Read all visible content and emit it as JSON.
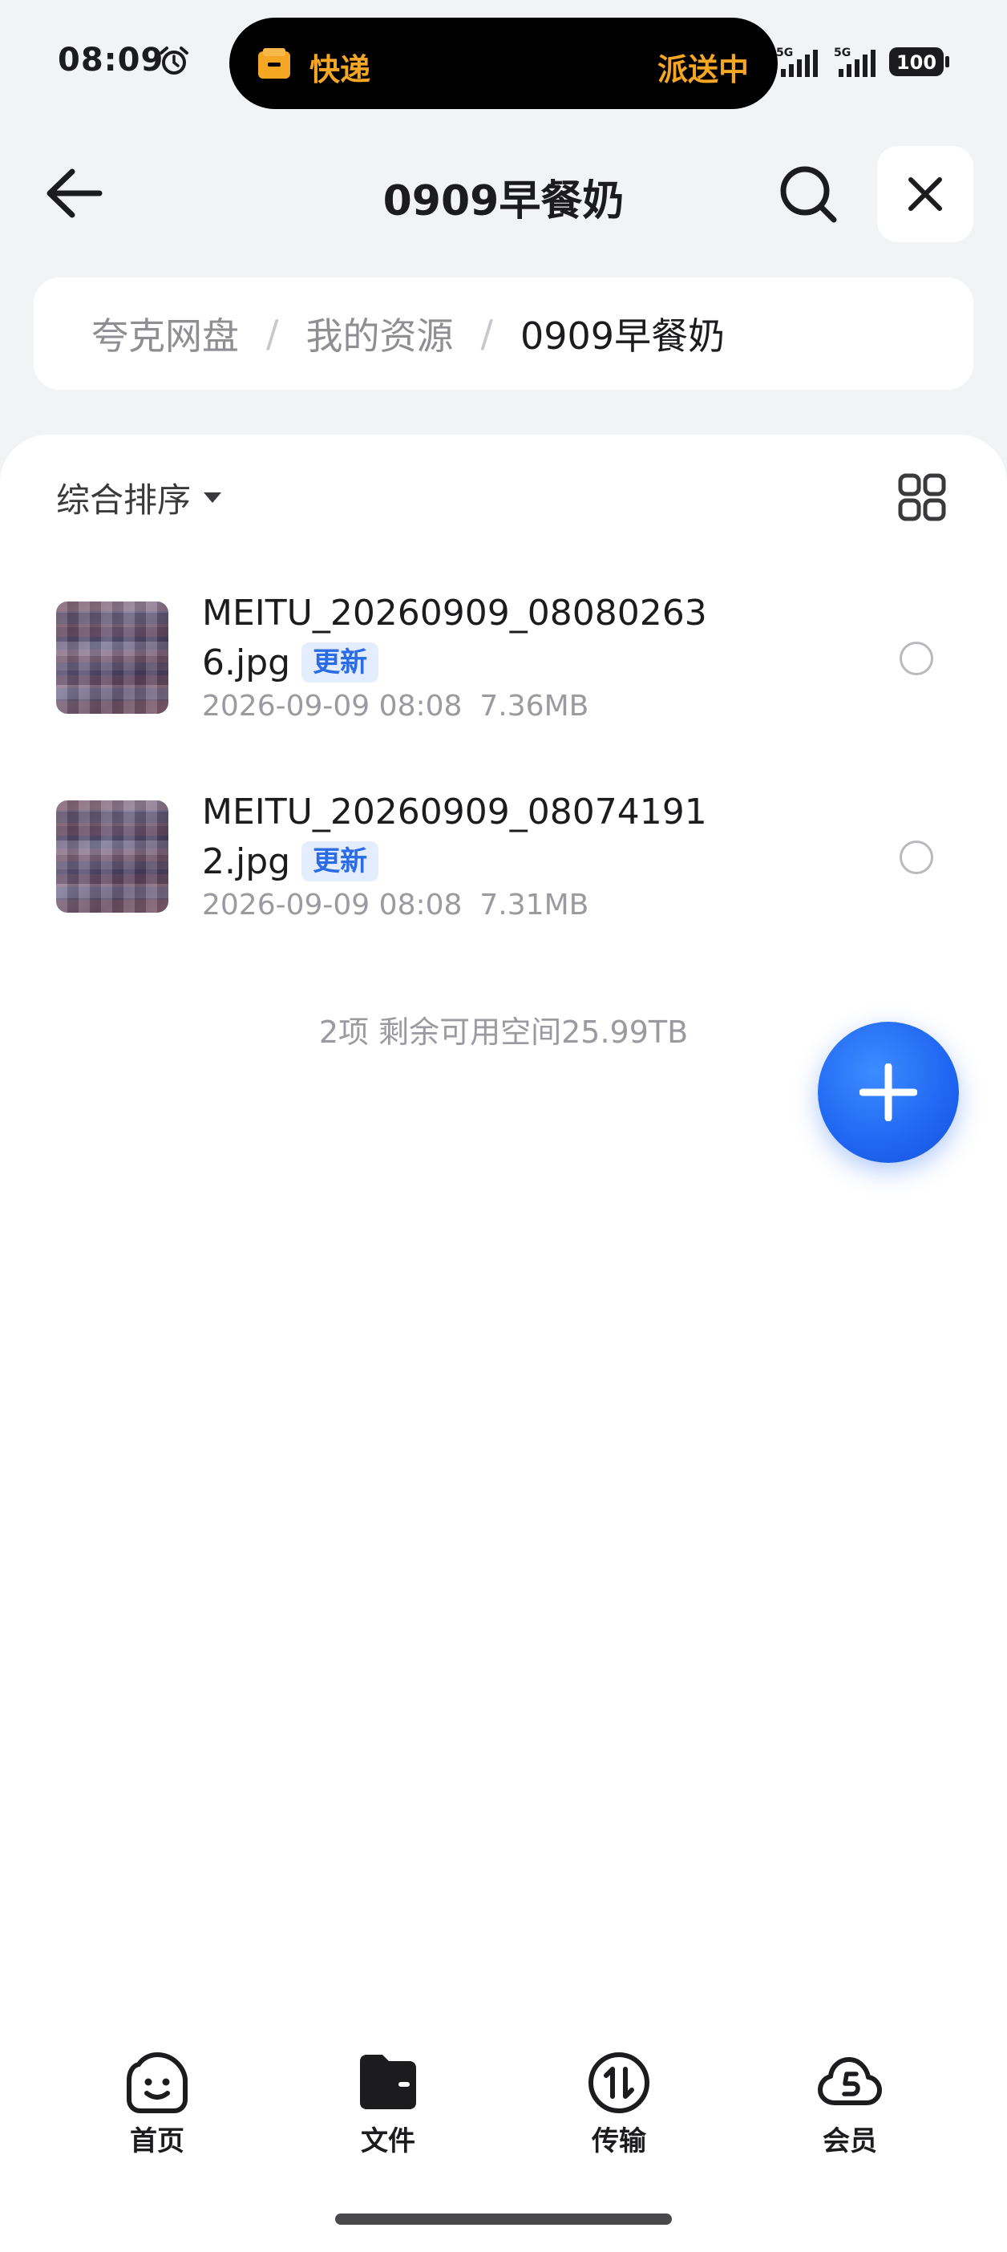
{
  "status_bar": {
    "time": "08:09",
    "island": {
      "left_label": "快递",
      "right_label": "派送中",
      "accent": "#f5a623"
    },
    "battery": "100",
    "signal_labels": [
      "5G",
      "5G"
    ]
  },
  "header": {
    "title": "0909早餐奶"
  },
  "breadcrumb": {
    "items": [
      "夸克网盘",
      "我的资源",
      "0909早餐奶"
    ],
    "separator": "/"
  },
  "toolbar": {
    "sort_label": "综合排序"
  },
  "files": [
    {
      "name": "MEITU_20260909_080802636.jpg",
      "badge": "更新",
      "date": "2026-09-09 08:08",
      "size": "7.36MB"
    },
    {
      "name": "MEITU_20260909_080741912.jpg",
      "badge": "更新",
      "date": "2026-09-09 08:08",
      "size": "7.31MB"
    }
  ],
  "summary": "2项 剩余可用空间25.99TB",
  "bottom_nav": {
    "items": [
      {
        "label": "首页",
        "icon": "home-face-icon"
      },
      {
        "label": "文件",
        "icon": "folder-icon"
      },
      {
        "label": "传输",
        "icon": "transfer-icon"
      },
      {
        "label": "会员",
        "icon": "member-cloud-icon"
      }
    ],
    "active_index": 1
  },
  "colors": {
    "primary": "#1f66f2",
    "badge_bg": "#e3edfd",
    "badge_text": "#2a6be6"
  }
}
